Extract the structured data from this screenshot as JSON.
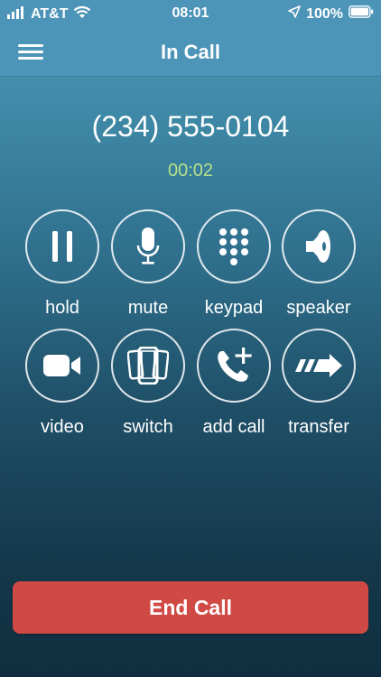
{
  "status_bar": {
    "carrier": "AT&T",
    "time": "08:01",
    "battery": "100%"
  },
  "nav": {
    "title": "In Call"
  },
  "call": {
    "number": "(234) 555-0104",
    "duration": "00:02"
  },
  "controls": [
    {
      "label": "hold",
      "icon": "pause-icon"
    },
    {
      "label": "mute",
      "icon": "microphone-icon"
    },
    {
      "label": "keypad",
      "icon": "keypad-icon"
    },
    {
      "label": "speaker",
      "icon": "speaker-icon"
    },
    {
      "label": "video",
      "icon": "video-camera-icon"
    },
    {
      "label": "switch",
      "icon": "switch-devices-icon"
    },
    {
      "label": "add call",
      "icon": "add-call-icon"
    },
    {
      "label": "transfer",
      "icon": "transfer-arrow-icon"
    }
  ],
  "end_call_label": "End Call",
  "colors": {
    "header": "#4c94b8",
    "timer": "#b7e08a",
    "end_call": "#cf4a45"
  }
}
